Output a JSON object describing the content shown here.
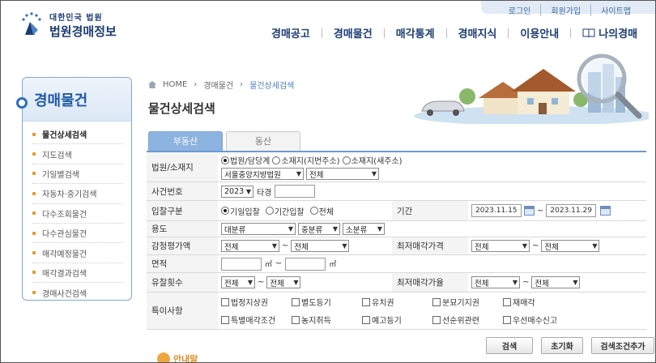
{
  "util_links": [
    "로그인",
    "회원가입",
    "사이트맵"
  ],
  "logo": {
    "sub": "대한민국 법원",
    "main": "법원경매정보"
  },
  "nav": [
    "경매공고",
    "경매물건",
    "매각통계",
    "경매지식",
    "이용안내"
  ],
  "nav_my": "나의경매",
  "sidebar": {
    "title": "경매물건",
    "items": [
      {
        "label": "물건상세검색",
        "active": true
      },
      {
        "label": "지도검색"
      },
      {
        "label": "기일별검색"
      },
      {
        "label": "자동차·중기검색"
      },
      {
        "label": "다수조회물건"
      },
      {
        "label": "다수관심물건"
      },
      {
        "label": "매각예정물건"
      },
      {
        "label": "매각결과검색"
      },
      {
        "label": "경매사건검색"
      }
    ]
  },
  "breadcrumb": {
    "home": "HOME",
    "mid": "경매물건",
    "current": "물건상세검색"
  },
  "page_title": "물건상세검색",
  "tabs": [
    {
      "label": "부동산",
      "active": true
    },
    {
      "label": "동산"
    }
  ],
  "form": {
    "court_label": "법원/소재지",
    "court_radios": [
      "법원/담당계",
      "소재지(지번주소)",
      "소재지(새주소)"
    ],
    "court_select": "서울중앙지방법원",
    "dept_select": "전체",
    "case_label": "사건번호",
    "case_year": "2023",
    "case_type": "타경",
    "case_no": "",
    "bid_label": "입찰구분",
    "bid_radios": [
      "기일입찰",
      "기간입찰",
      "전체"
    ],
    "period_label": "기간",
    "date_from": "2023.11.15",
    "date_to": "2023.11.29",
    "use_label": "용도",
    "use_selects": [
      "대분류",
      "중분류",
      "소분류"
    ],
    "appraisal_label": "감정평가액",
    "appraisal_from": "전체",
    "appraisal_to": "전체",
    "min_price_label": "최저매각가격",
    "min_price_from": "전체",
    "min_price_to": "전체",
    "area_label": "면적",
    "area_unit": "㎡",
    "fail_label": "유찰횟수",
    "fail_from": "전체",
    "fail_to": "전체",
    "min_rate_label": "최저매각가율",
    "min_rate_from": "전체",
    "min_rate_to": "전체",
    "special_label": "특이사항",
    "special_row1": [
      "법정지상권",
      "별도등기",
      "유치권",
      "분묘기지권",
      "재매각"
    ],
    "special_row2": [
      "특별매각조건",
      "농지취득",
      "예고등기",
      "선순위관련",
      "우선매수신고"
    ],
    "tilde": "~"
  },
  "buttons": [
    "검색",
    "초기화",
    "검색조건추가"
  ],
  "notice": "안내말",
  "colors": {
    "brand": "#1c3d74",
    "accent": "#2d6fc0",
    "tab_active": "#8db3e0"
  }
}
